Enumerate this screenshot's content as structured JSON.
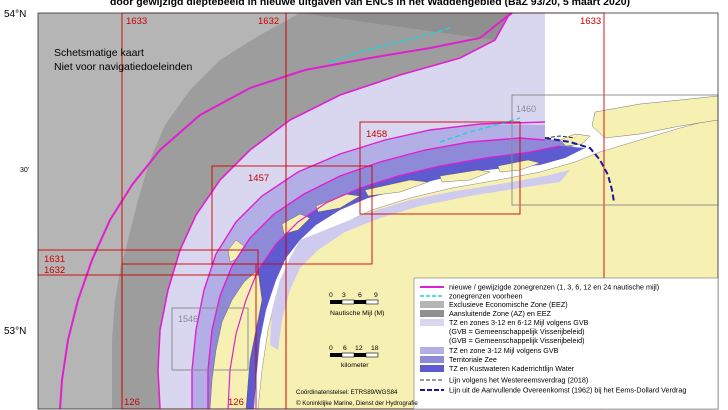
{
  "title": "door gewijzigd dieptebeeld in nieuwe uitgaven van ENCs in het Waddengebied (BaZ 93/20, 5 maart 2020)",
  "labels": {
    "lat_54": "54°N",
    "lat_30": "30'",
    "lat_53": "53°N"
  },
  "cells": {
    "c1633a": "1633",
    "c1632": "1632",
    "c1633b": "1633",
    "c1457": "1457",
    "c1458": "1458",
    "c1631": "1631",
    "c1632b": "1632",
    "c126a": "126",
    "c126b": "126",
    "c1546": "1546",
    "c1460": "1460"
  },
  "notes": {
    "line1": "Schetsmatige kaart",
    "line2": "Niet voor navigatiedoeleinden"
  },
  "legend": {
    "new_zones": "nieuwe / gewijzigde zonegrenzen (1, 3, 6, 12 en 24 nautische mijl)",
    "previous_zones": "zonegrenzen voorheen",
    "eez": "Exclusieve Economische Zone (EEZ)",
    "az": "Aansluitende Zone (AZ) en EEZ",
    "tz_gvb": "TZ en zones 3-12 en 6-12 Mijl volgens GVB",
    "gvb_note": "(GVB = Gemeenschappelijk Visserijbeleid)",
    "tz_3_12": "TZ en zone 3-12 Mijl volgens GVB",
    "territorial": "Territoriale Zee",
    "coastal": "TZ en Kustwateren Kaderrichtlijn Water",
    "westereems": "Lijn volgens het Westereemsverdrag (2018)",
    "ems_dollard": "Lijn uit de Aanvullende Overeenkomst (1962) bij het Eems-Dollard Verdrag"
  },
  "scale": {
    "nm_0": "0",
    "nm_3": "3",
    "nm_6": "6",
    "nm_9": "9",
    "nm_unit": "Nautische Mijl (M)",
    "km_0": "0",
    "km_6": "6",
    "km_12": "12",
    "km_18": "18",
    "km_unit": "kilometer"
  },
  "credits": {
    "crs": "Coördinatenstelsel: ETRS89/WGS84",
    "copyright": "© Koninklijke Marine, Dienst der Hydrografie"
  },
  "colors": {
    "new_zone_line": "#e020d0",
    "previous_zone_line": "#20d0e0",
    "enc_cell_frame": "#cc0000",
    "land": "#f7f0b3",
    "coastal_waters": "#5e5ad0",
    "territorial_sea": "#8f8ad8",
    "ems_dollard_line": "#1a1aa0"
  }
}
